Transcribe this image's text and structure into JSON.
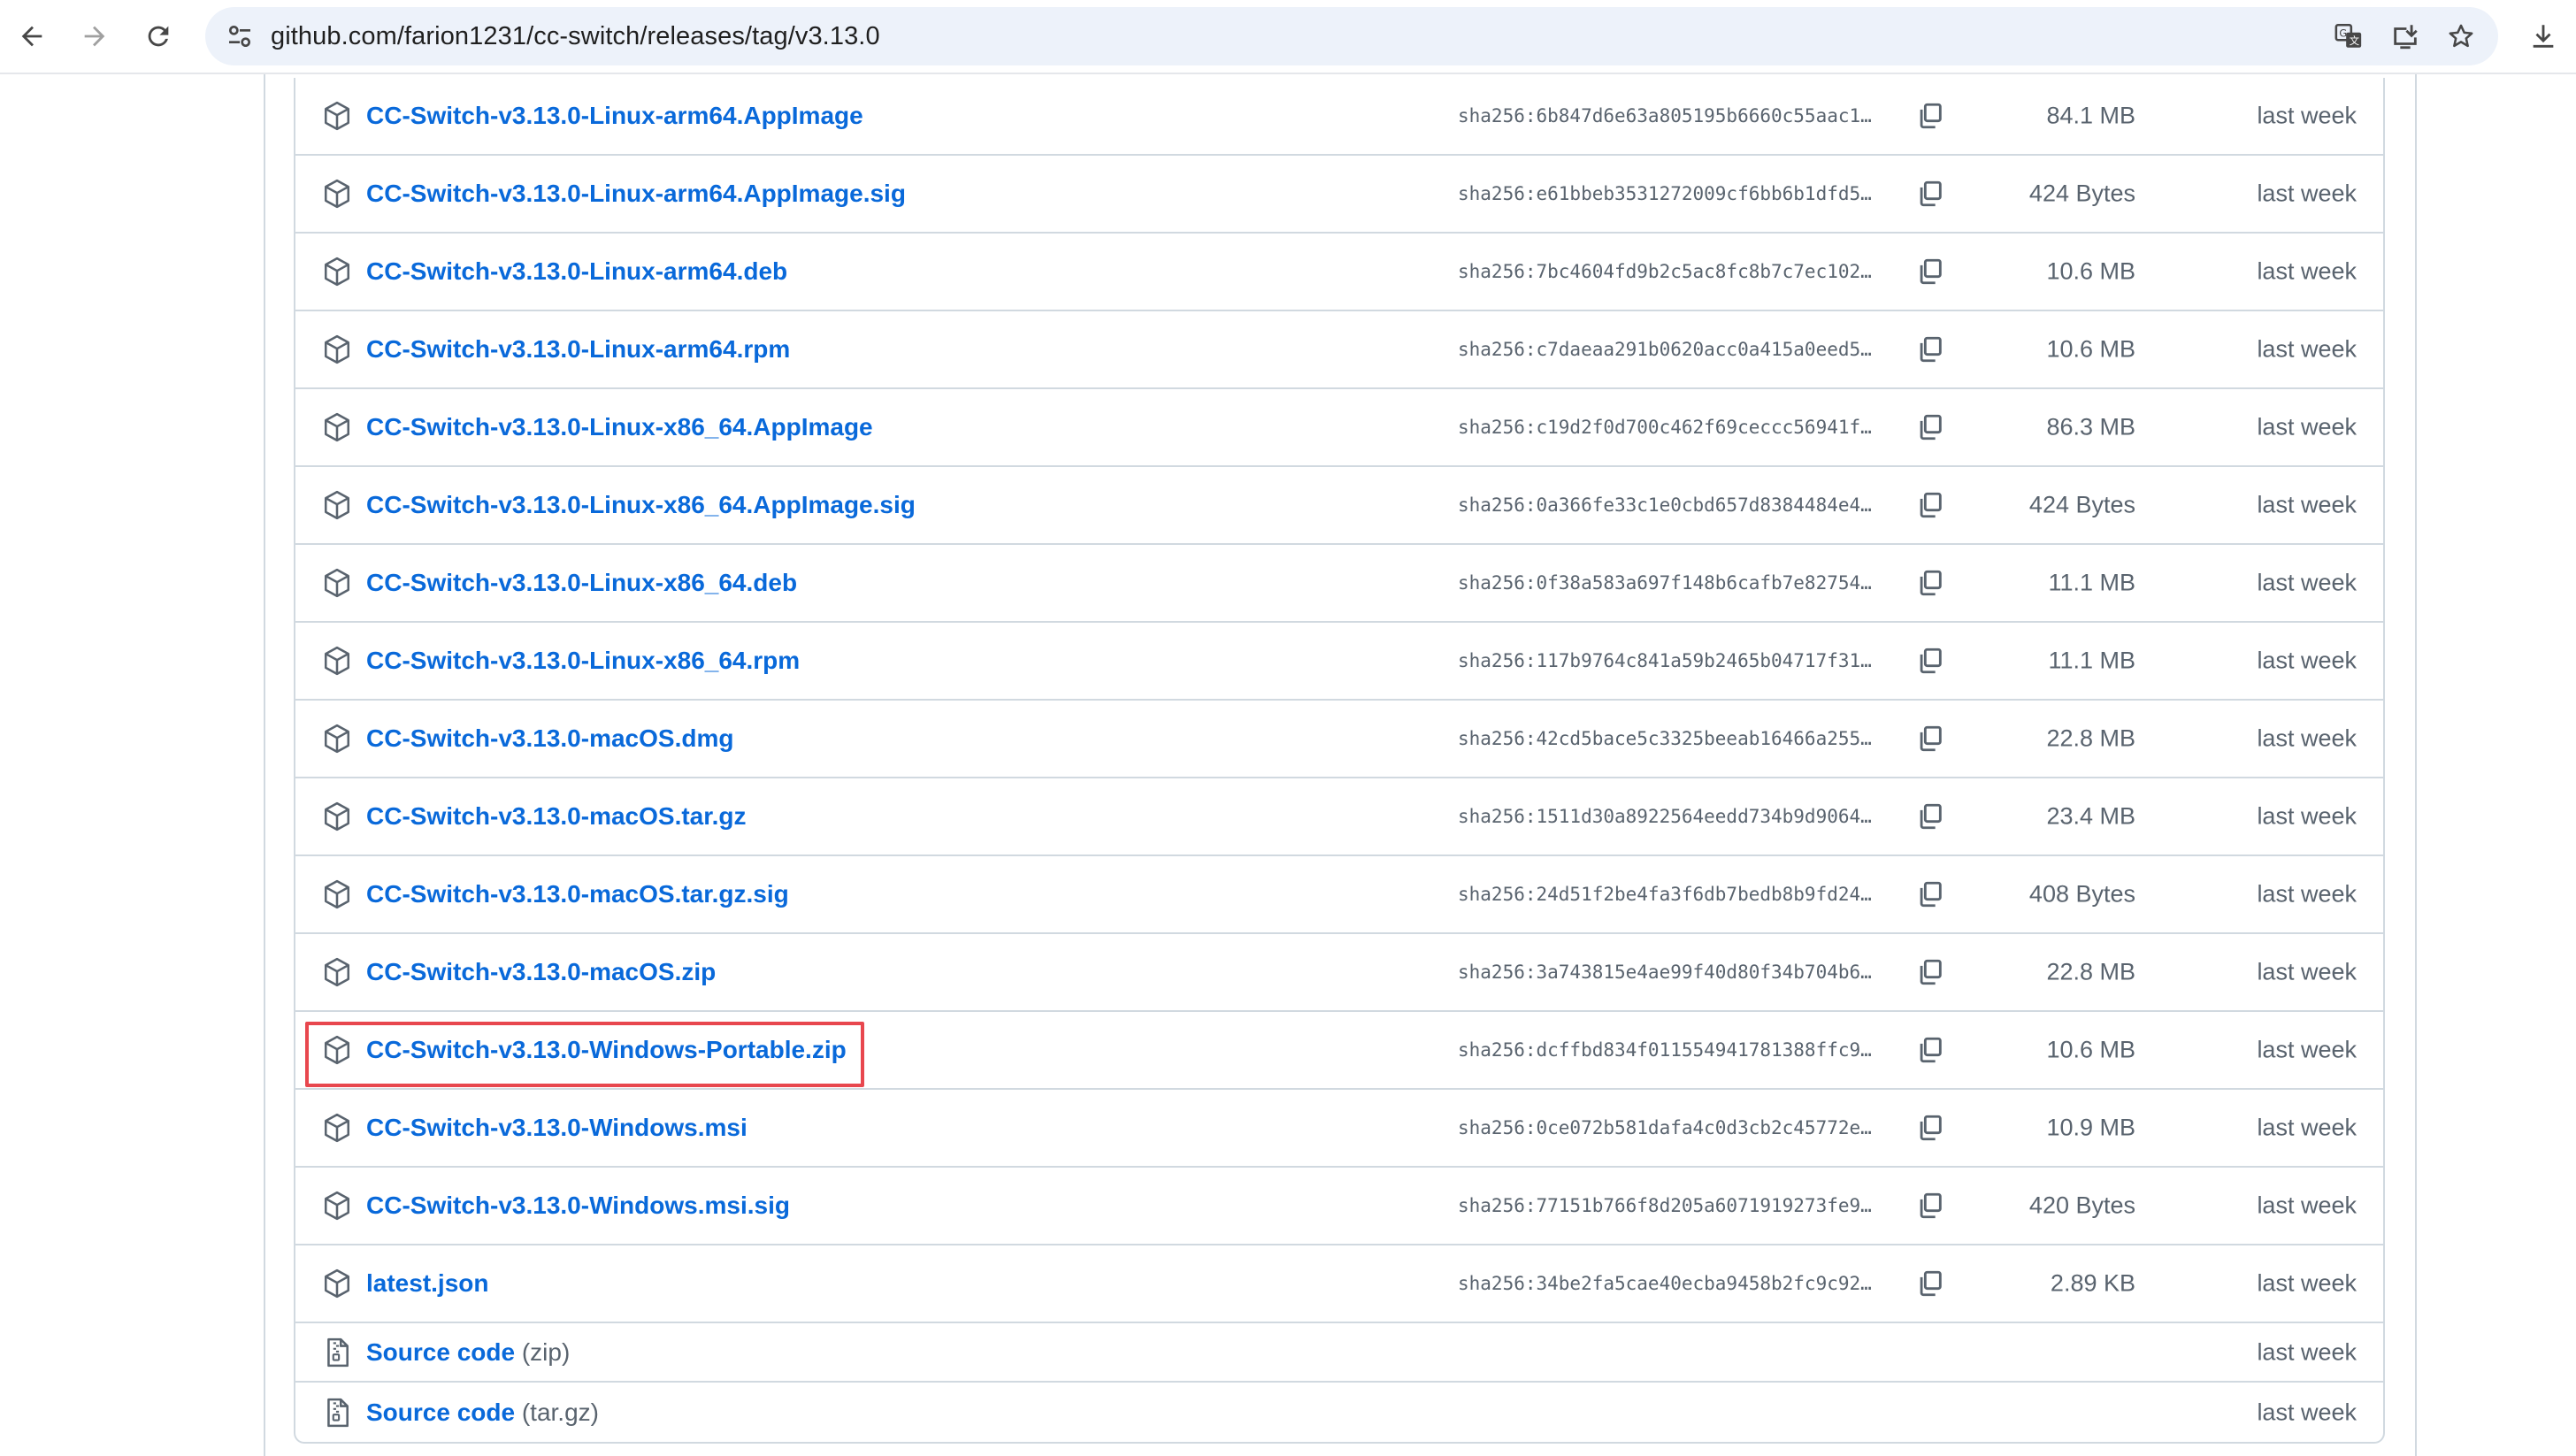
{
  "browser": {
    "url": "github.com/farion1231/cc-switch/releases/tag/v3.13.0"
  },
  "assets": [
    {
      "name": "CC-Switch-v3.13.0-Linux-arm64.AppImage",
      "sha": "sha256:6b847d6e63a805195b6660c55aac1…",
      "size": "84.1 MB",
      "date": "last week"
    },
    {
      "name": "CC-Switch-v3.13.0-Linux-arm64.AppImage.sig",
      "sha": "sha256:e61bbeb3531272009cf6bb6b1dfd5…",
      "size": "424 Bytes",
      "date": "last week"
    },
    {
      "name": "CC-Switch-v3.13.0-Linux-arm64.deb",
      "sha": "sha256:7bc4604fd9b2c5ac8fc8b7c7ec102…",
      "size": "10.6 MB",
      "date": "last week"
    },
    {
      "name": "CC-Switch-v3.13.0-Linux-arm64.rpm",
      "sha": "sha256:c7daeaa291b0620acc0a415a0eed5…",
      "size": "10.6 MB",
      "date": "last week"
    },
    {
      "name": "CC-Switch-v3.13.0-Linux-x86_64.AppImage",
      "sha": "sha256:c19d2f0d700c462f69ceccc56941f…",
      "size": "86.3 MB",
      "date": "last week"
    },
    {
      "name": "CC-Switch-v3.13.0-Linux-x86_64.AppImage.sig",
      "sha": "sha256:0a366fe33c1e0cbd657d8384484e4…",
      "size": "424 Bytes",
      "date": "last week"
    },
    {
      "name": "CC-Switch-v3.13.0-Linux-x86_64.deb",
      "sha": "sha256:0f38a583a697f148b6cafb7e82754…",
      "size": "11.1 MB",
      "date": "last week"
    },
    {
      "name": "CC-Switch-v3.13.0-Linux-x86_64.rpm",
      "sha": "sha256:117b9764c841a59b2465b04717f31…",
      "size": "11.1 MB",
      "date": "last week"
    },
    {
      "name": "CC-Switch-v3.13.0-macOS.dmg",
      "sha": "sha256:42cd5bace5c3325beeab16466a255…",
      "size": "22.8 MB",
      "date": "last week"
    },
    {
      "name": "CC-Switch-v3.13.0-macOS.tar.gz",
      "sha": "sha256:1511d30a8922564eedd734b9d9064…",
      "size": "23.4 MB",
      "date": "last week"
    },
    {
      "name": "CC-Switch-v3.13.0-macOS.tar.gz.sig",
      "sha": "sha256:24d51f2be4fa3f6db7bedb8b9fd24…",
      "size": "408 Bytes",
      "date": "last week"
    },
    {
      "name": "CC-Switch-v3.13.0-macOS.zip",
      "sha": "sha256:3a743815e4ae99f40d80f34b704b6…",
      "size": "22.8 MB",
      "date": "last week"
    },
    {
      "name": "CC-Switch-v3.13.0-Windows-Portable.zip",
      "sha": "sha256:dcffbd834f011554941781388ffc9…",
      "size": "10.6 MB",
      "date": "last week"
    },
    {
      "name": "CC-Switch-v3.13.0-Windows.msi",
      "sha": "sha256:0ce072b581dafa4c0d3cb2c45772e…",
      "size": "10.9 MB",
      "date": "last week"
    },
    {
      "name": "CC-Switch-v3.13.0-Windows.msi.sig",
      "sha": "sha256:77151b766f8d205a6071919273fe9…",
      "size": "420 Bytes",
      "date": "last week"
    },
    {
      "name": "latest.json",
      "sha": "sha256:34be2fa5cae40ecba9458b2fc9c92…",
      "size": "2.89 KB",
      "date": "last week"
    }
  ],
  "sources": [
    {
      "label": "Source code",
      "ext": "(zip)",
      "date": "last week"
    },
    {
      "label": "Source code",
      "ext": "(tar.gz)",
      "date": "last week"
    }
  ],
  "icons": {
    "back": "arrow-left-icon",
    "forward": "arrow-right-icon",
    "reload": "reload-icon",
    "site_info": "tune-icon",
    "translate": "translate-icon",
    "install": "install-app-icon",
    "bookmark": "star-icon",
    "downloads": "download-icon",
    "asset": "package-icon",
    "source": "file-zip-icon",
    "copy": "copy-icon"
  },
  "colors": {
    "link": "#0969da",
    "muted": "#59636e",
    "border": "#d1d9e0",
    "highlight": "#e8474e",
    "omnibox": "#edf2fa"
  }
}
